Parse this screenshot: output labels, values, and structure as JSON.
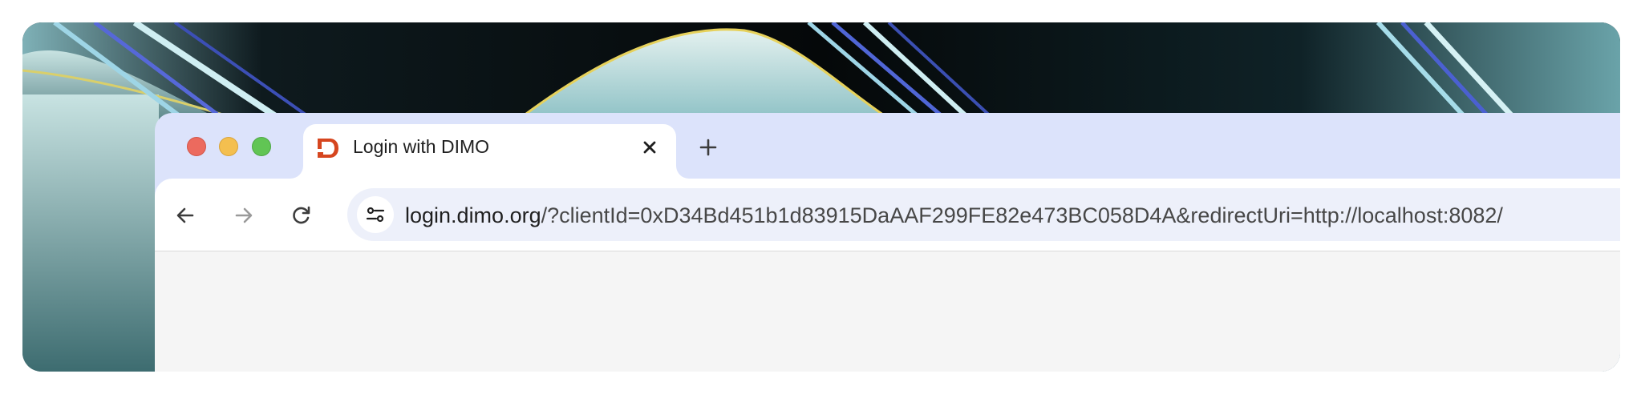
{
  "window": {
    "traffic_lights": [
      "close",
      "minimize",
      "maximize"
    ]
  },
  "tab": {
    "title": "Login with DIMO",
    "favicon": "dimo-logo-icon",
    "favicon_color": "#d6461f",
    "close_icon": "close-icon"
  },
  "toolbar": {
    "new_tab_icon": "plus-icon",
    "back_icon": "arrow-left-icon",
    "forward_icon": "arrow-right-icon",
    "reload_icon": "reload-icon",
    "site_info_icon": "tune-icon"
  },
  "address_bar": {
    "host": "login.dimo.org",
    "path": "/?clientId=0xD34Bd451b1d83915DaAAF299FE82e473BC058D4A&redirectUri=http://localhost:8082/"
  },
  "colors": {
    "tab_strip": "#dce3fb",
    "omnibox": "#edf0fa",
    "content": "#f5f5f5"
  }
}
